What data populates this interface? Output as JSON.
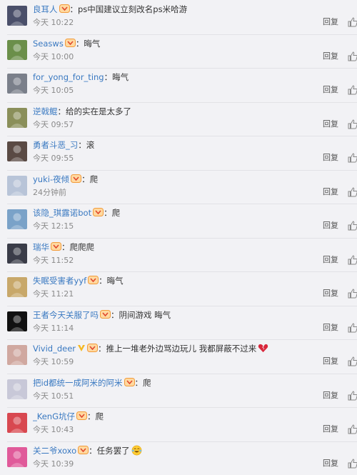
{
  "comments": [
    {
      "name": "良耳人",
      "badge": true,
      "text": "ps中国建议立刻改名ps米哈游",
      "emoji": "",
      "time": "今天 10:22",
      "reply": "回复",
      "avatar": "#4a4f6a",
      "avatar_icon": "dark-anime-avatar-icon"
    },
    {
      "name": "Seasws",
      "badge": true,
      "text": "晦气",
      "emoji": "",
      "time": "今天 10:00",
      "reply": "回复",
      "avatar": "#6b8f4a",
      "avatar_icon": "green-character-avatar-icon"
    },
    {
      "name": "for_yong_for_ting",
      "badge": false,
      "text": "晦气",
      "emoji": "",
      "time": "今天 10:05",
      "reply": "回复",
      "avatar": "#7a7f8a",
      "avatar_icon": "grey-figure-avatar-icon"
    },
    {
      "name": "逆戟鲲",
      "badge": false,
      "text": "给的实在是太多了",
      "emoji": "",
      "time": "今天 09:57",
      "reply": "回复",
      "avatar": "#8a8f5a",
      "avatar_icon": "olive-character-avatar-icon"
    },
    {
      "name": "勇者斗恶_习",
      "badge": false,
      "text": "滚",
      "emoji": "",
      "time": "今天 09:55",
      "reply": "回复",
      "avatar": "#5a4a44",
      "avatar_icon": "brown-person-avatar-icon"
    },
    {
      "name": "yuki-夜倾",
      "badge": true,
      "text": "爬",
      "emoji": "",
      "time": "24分钟前",
      "reply": "回复",
      "avatar": "#b8c4d8",
      "avatar_icon": "white-hair-anime-avatar-icon"
    },
    {
      "name": "该隐_琪露诺bot",
      "badge": true,
      "text": "爬",
      "emoji": "",
      "time": "今天 12:15",
      "reply": "回复",
      "avatar": "#7aa2c8",
      "avatar_icon": "blue-anime-avatar-icon"
    },
    {
      "name": "瑞华",
      "badge": true,
      "text": "爬爬爬",
      "emoji": "",
      "time": "今天 11:52",
      "reply": "回复",
      "avatar": "#3a3c48",
      "avatar_icon": "silhouette-avatar-icon"
    },
    {
      "name": "失眠受害者yyf",
      "badge": true,
      "text": "晦气",
      "emoji": "",
      "time": "今天 11:21",
      "reply": "回复",
      "avatar": "#c8a86a",
      "avatar_icon": "cartoon-avatar-icon"
    },
    {
      "name": "王者今天关服了吗",
      "badge": true,
      "text": "阴间游戏 晦气",
      "emoji": "",
      "time": "今天 11:14",
      "reply": "回复",
      "avatar": "#111111",
      "avatar_icon": "black-avatar-icon"
    },
    {
      "name": "Vivid_deer",
      "badge": true,
      "vbadge": true,
      "text": "推上一堆老外边骂边玩儿 我都屏蔽不过来",
      "emoji": "broken-heart",
      "time": "今天 10:59",
      "reply": "回复",
      "avatar": "#d0a8a0",
      "avatar_icon": "pink-anime-avatar-icon"
    },
    {
      "name": "把id都统一成阿米的阿米",
      "badge": true,
      "text": "爬",
      "emoji": "",
      "time": "今天 10:51",
      "reply": "回复",
      "avatar": "#c8c8d8",
      "avatar_icon": "light-anime-avatar-icon"
    },
    {
      "name": "_KenG坑仔",
      "badge": true,
      "text": "爬",
      "emoji": "",
      "time": "今天 10:43",
      "reply": "回复",
      "avatar": "#d84850",
      "avatar_icon": "red-anime-avatar-icon"
    },
    {
      "name": "关二爷xoxo",
      "badge": true,
      "text": "任务罢了",
      "emoji": "laugh-cry",
      "time": "今天 10:39",
      "reply": "回复",
      "avatar": "#e05a9a",
      "avatar_icon": "pink-avatar-icon"
    }
  ]
}
